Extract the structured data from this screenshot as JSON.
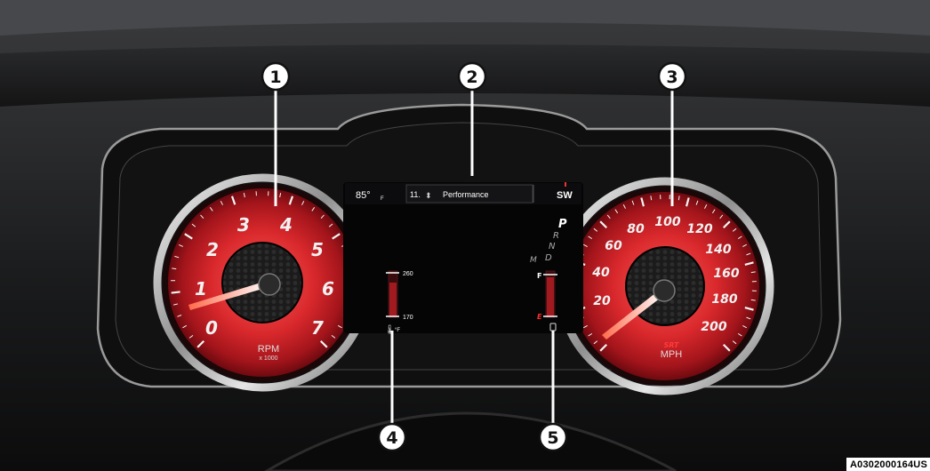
{
  "tachometer": {
    "numbers": [
      "0",
      "1",
      "2",
      "3",
      "4",
      "5",
      "6",
      "7"
    ],
    "unit": "RPM",
    "scale": "x 1000"
  },
  "speedometer": {
    "numbers": [
      "20",
      "40",
      "60",
      "80",
      "100",
      "120",
      "140",
      "160",
      "180",
      "200"
    ],
    "badge": "SRT",
    "unit": "MPH"
  },
  "display": {
    "temperature": "85°",
    "temperature_unit": "F",
    "menu_index": "11.",
    "menu_title": "Performance",
    "compass": "SW",
    "gear_letters": [
      "P",
      "R",
      "N",
      "D"
    ],
    "manual_mode": "M",
    "coolant_high": "260",
    "coolant_low": "170",
    "coolant_unit": "°F",
    "fuel_full": "F",
    "fuel_empty": "E"
  },
  "callouts": [
    "1",
    "2",
    "3",
    "4",
    "5"
  ],
  "reference_code": "A0302000164US"
}
